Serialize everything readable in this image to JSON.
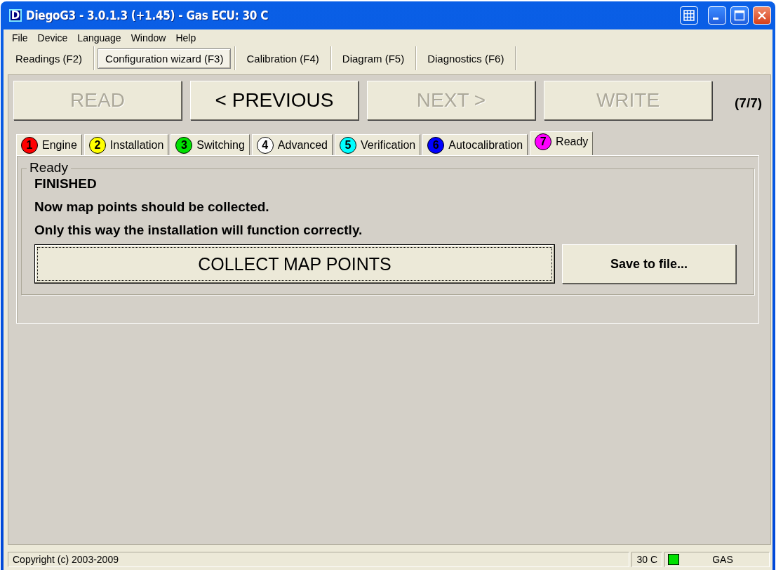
{
  "window": {
    "app_icon_letter": "D",
    "title": "DiegoG3 - 3.0.1.3 (+1.45) - Gas ECU: 30 C"
  },
  "menu": [
    {
      "label": "File"
    },
    {
      "label": "Device"
    },
    {
      "label": "Language"
    },
    {
      "label": "Window"
    },
    {
      "label": "Help"
    }
  ],
  "mode_tabs": [
    {
      "label": "Readings (F2)",
      "selected": false
    },
    {
      "label": "Configuration wizard (F3)",
      "selected": true
    },
    {
      "label": "Calibration (F4)",
      "selected": false
    },
    {
      "label": "Diagram (F5)",
      "selected": false
    },
    {
      "label": "Diagnostics (F6)",
      "selected": false
    }
  ],
  "wizard_buttons": [
    {
      "label": "READ",
      "disabled": true
    },
    {
      "label": "< PREVIOUS",
      "disabled": false
    },
    {
      "label": "NEXT >",
      "disabled": true
    },
    {
      "label": "WRITE",
      "disabled": true
    }
  ],
  "step_counter": "(7/7)",
  "steps": [
    {
      "number": "1",
      "label": "Engine",
      "color": "#ff0000",
      "selected": false
    },
    {
      "number": "2",
      "label": "Installation",
      "color": "#ffff00",
      "selected": false
    },
    {
      "number": "3",
      "label": "Switching",
      "color": "#00e000",
      "selected": false
    },
    {
      "number": "4",
      "label": "Advanced",
      "color": "#ffffff",
      "selected": false
    },
    {
      "number": "5",
      "label": "Verification",
      "color": "#00ffff",
      "selected": false
    },
    {
      "number": "6",
      "label": "Autocalibration",
      "color": "#0000ff",
      "selected": false
    },
    {
      "number": "7",
      "label": "Ready",
      "color": "#ff00ff",
      "selected": true
    }
  ],
  "group": {
    "title": "Ready",
    "lines": [
      "FINISHED",
      "Now map points should be collected.",
      "Only this way the installation will function correctly."
    ],
    "buttons": [
      {
        "label": "COLLECT MAP POINTS",
        "kind": "primary"
      },
      {
        "label": "Save to file...",
        "kind": "secondary"
      }
    ]
  },
  "status_bar": {
    "text": "Copyright (c) 2003-2009",
    "temperature": "30 C",
    "gas_indicator_on": true,
    "fuel": "GAS"
  }
}
